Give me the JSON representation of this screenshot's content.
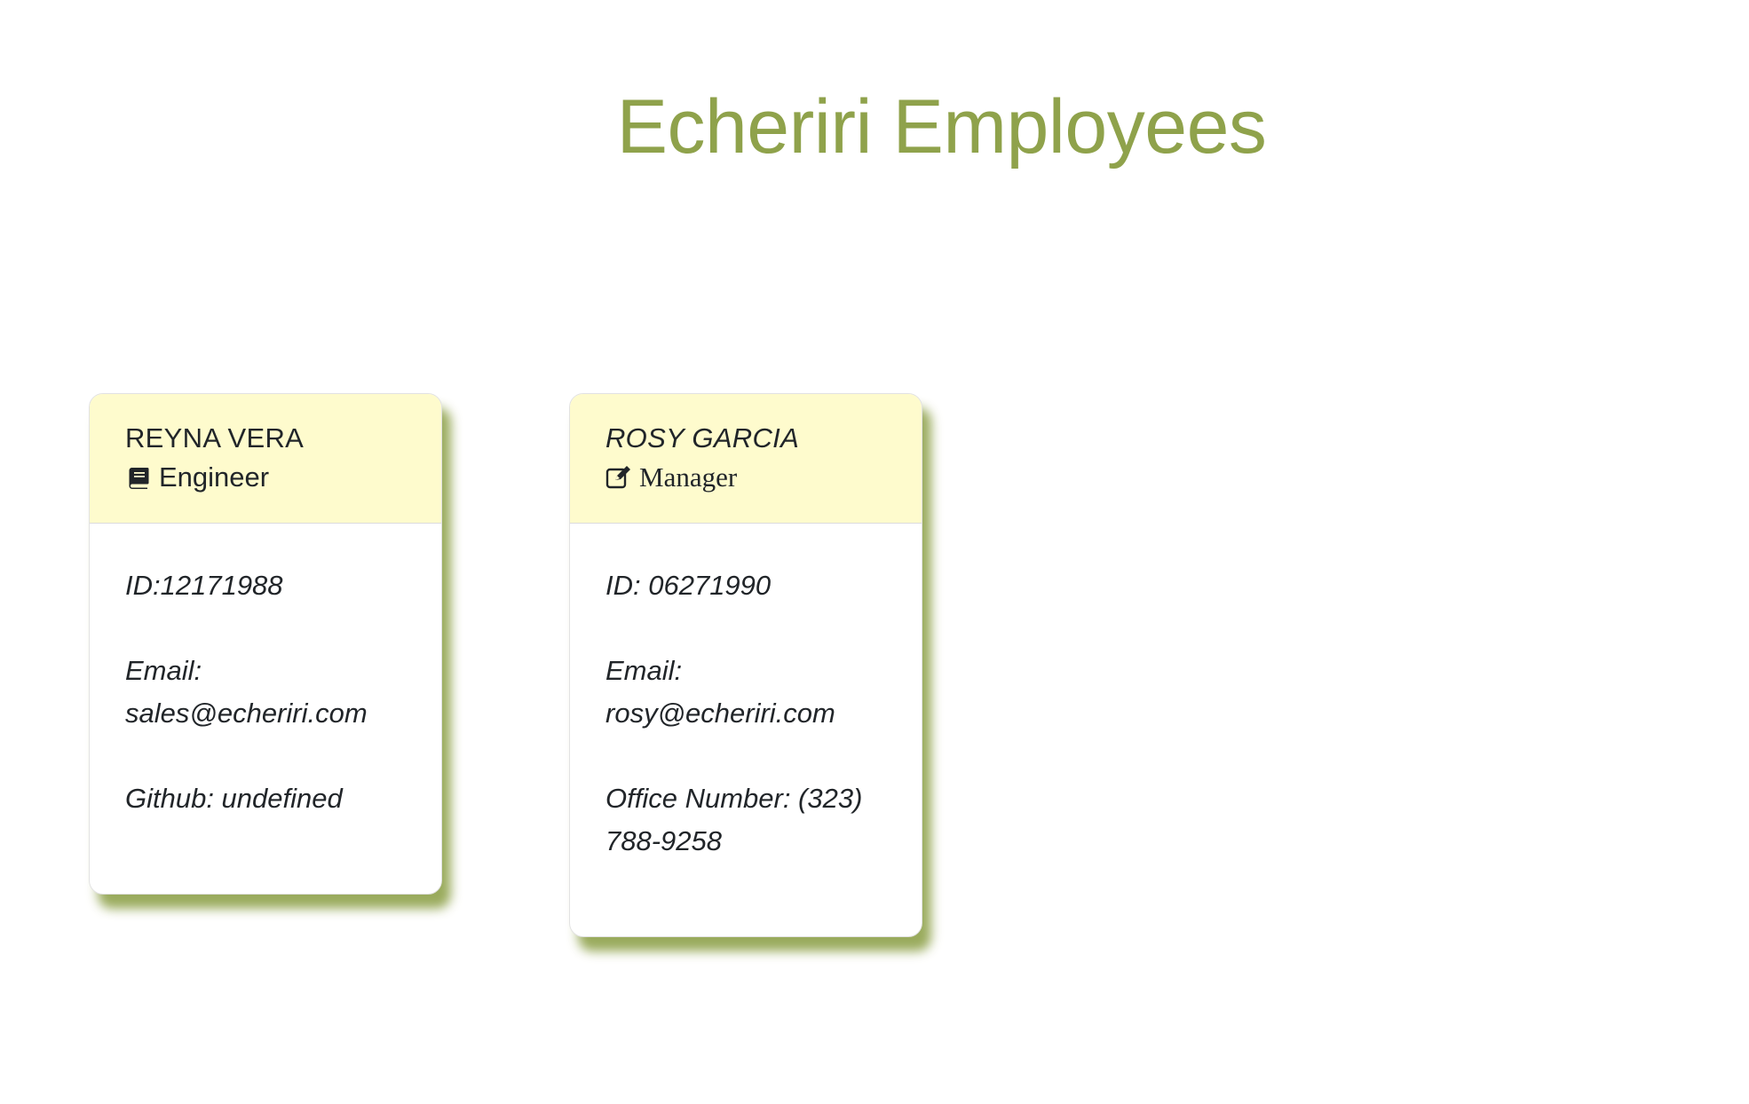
{
  "page": {
    "title": "Echeriri Employees"
  },
  "colors": {
    "title": "#8fa24b",
    "header_bg": "#fefbcd",
    "shadow": "#8fa24b"
  },
  "employees": [
    {
      "name": "REYNA VERA",
      "role": "Engineer",
      "role_icon": "book-icon",
      "id_text": "ID:12171988",
      "email_label": "Email:",
      "email": "sales@echeriri.com",
      "extra_text": "Github: undefined"
    },
    {
      "name": "ROSY GARCIA",
      "role": "Manager",
      "role_icon": "edit-icon",
      "id_text": "ID: 06271990",
      "email_label": "Email:",
      "email": "rosy@echeriri.com",
      "extra_label": "Office Number: (323)",
      "extra_text": "788-9258"
    }
  ]
}
